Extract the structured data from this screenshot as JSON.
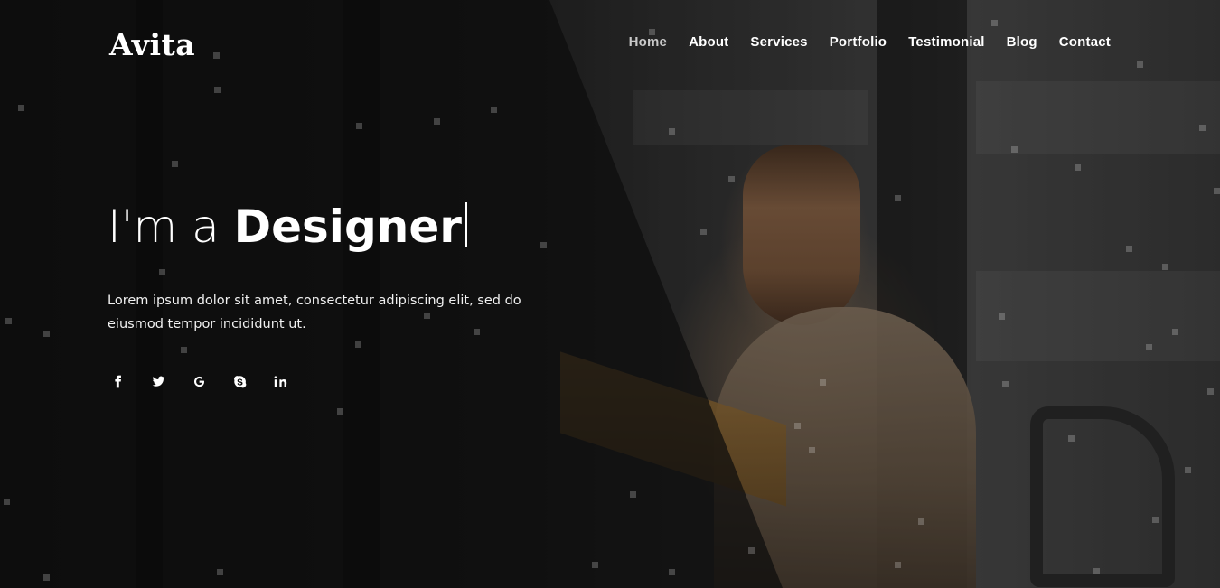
{
  "brand": {
    "logo": "Avita"
  },
  "nav": {
    "items": [
      {
        "label": "Home",
        "active": true
      },
      {
        "label": "About",
        "active": false
      },
      {
        "label": "Services",
        "active": false
      },
      {
        "label": "Portfolio",
        "active": false
      },
      {
        "label": "Testimonial",
        "active": false
      },
      {
        "label": "Blog",
        "active": false
      },
      {
        "label": "Contact",
        "active": false
      }
    ]
  },
  "hero": {
    "headline_prefix": "I'm a ",
    "headline_role": "Designer",
    "description": "Lorem ipsum dolor sit amet, consectetur adipiscing elit, sed do eiusmod tempor incididunt ut.",
    "social_icons": [
      "facebook-icon",
      "twitter-icon",
      "google-icon",
      "skype-icon",
      "linkedin-icon"
    ]
  },
  "colors": {
    "text": "#ffffff",
    "nav_active": "#c8c8c8",
    "overlay": "#0c0c0c"
  }
}
